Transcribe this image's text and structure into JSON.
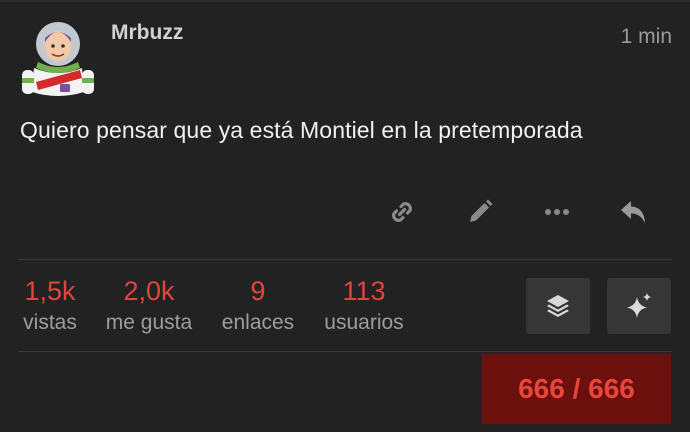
{
  "post": {
    "username": "Mrbuzz",
    "time": "1 min",
    "text": "Quiero pensar que ya está Montiel en la pretemporada",
    "avatar_icon": "buzz-lightyear-avatar"
  },
  "actions": [
    {
      "name": "copy-link",
      "icon": "link-icon"
    },
    {
      "name": "edit",
      "icon": "pencil-icon"
    },
    {
      "name": "more",
      "icon": "ellipsis-icon"
    },
    {
      "name": "reply",
      "icon": "reply-arrow-icon"
    }
  ],
  "stats": [
    {
      "value": "1,5k",
      "label": "vistas"
    },
    {
      "value": "2,0k",
      "label": "me gusta"
    },
    {
      "value": "9",
      "label": "enlaces"
    },
    {
      "value": "113",
      "label": "usuarios"
    }
  ],
  "buttons": {
    "summarize_icon": "layers-icon",
    "ai_icon": "sparkle-icon"
  },
  "progress": {
    "text": "666 / 666",
    "current": 666,
    "total": 666
  },
  "colors": {
    "background": "#222222",
    "accent": "#e0453c",
    "progress_bg": "#6b100c",
    "button_bg": "#363636"
  }
}
